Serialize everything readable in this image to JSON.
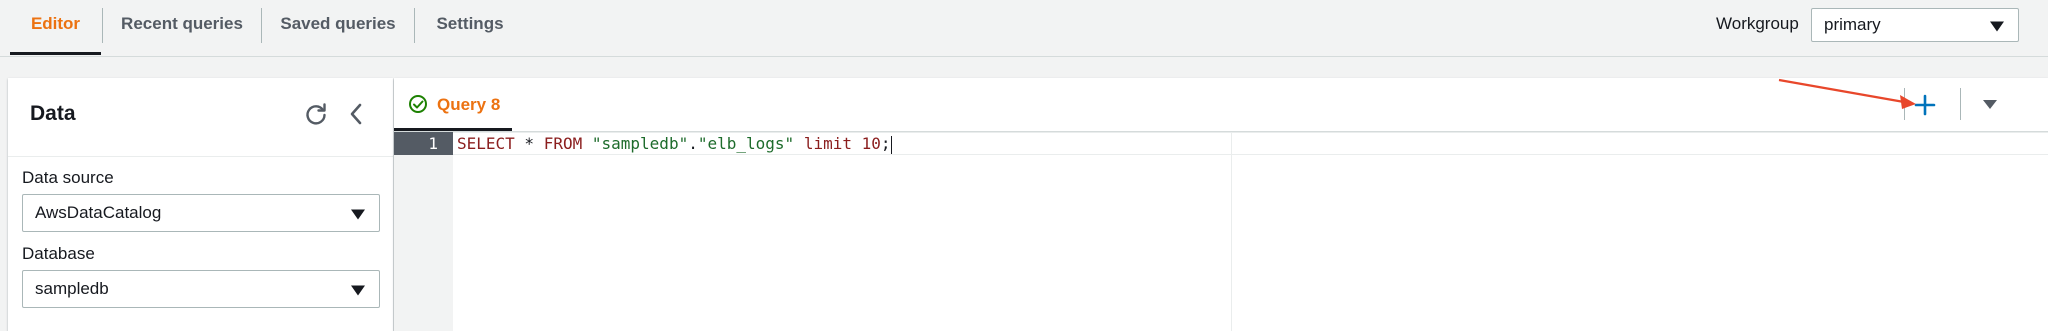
{
  "tabs": [
    {
      "label": "Editor",
      "active": true
    },
    {
      "label": "Recent queries"
    },
    {
      "label": "Saved queries"
    },
    {
      "label": "Settings"
    }
  ],
  "workgroup": {
    "label": "Workgroup",
    "value": "primary"
  },
  "data_panel": {
    "title": "Data",
    "data_source": {
      "label": "Data source",
      "value": "AwsDataCatalog"
    },
    "database": {
      "label": "Database",
      "value": "sampledb"
    }
  },
  "editor": {
    "query_tab": "Query 8",
    "line_number": "1",
    "code": {
      "kw_select": "SELECT",
      "star": " * ",
      "kw_from": "FROM",
      "db": "\"sampledb\"",
      "dot": ".",
      "table": "\"elb_logs\"",
      "kw_limit": "limit",
      "limit_value": "10",
      "semi": ";"
    }
  },
  "colors": {
    "accent": "#ec7211",
    "link": "#0073bb",
    "annotation_arrow": "#e8472b"
  }
}
